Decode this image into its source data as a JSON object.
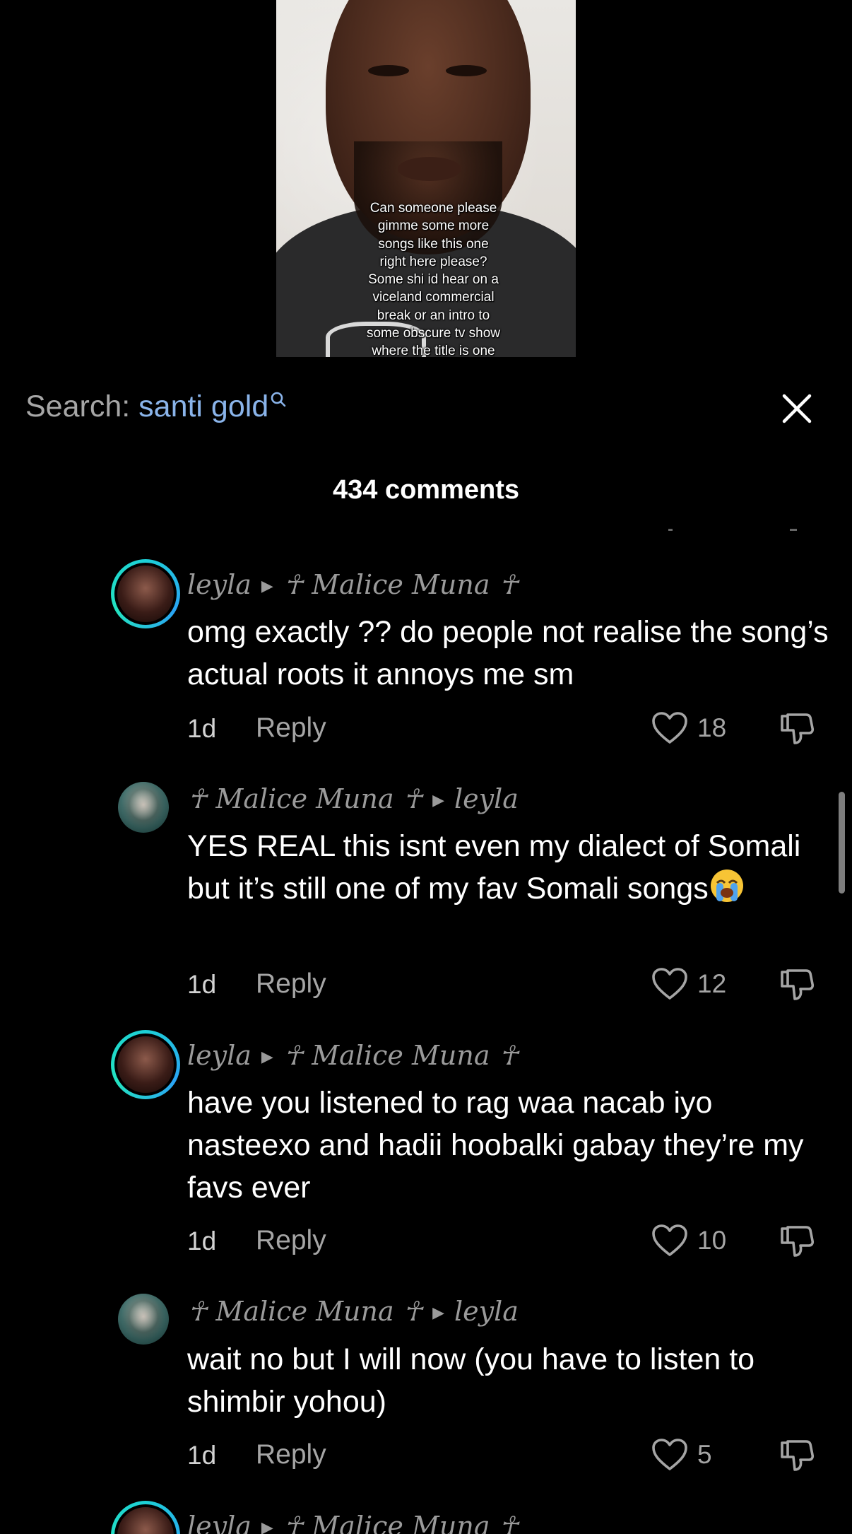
{
  "video": {
    "caption": "Can someone please gimme some more songs like this one right here please? Some shi id hear on a viceland commercial break or an intro to some obscure tv show where the title is one word type shi"
  },
  "search": {
    "label": "Search:",
    "query": "santi gold",
    "icon": "search-icon",
    "query_color": "#8ab4ea"
  },
  "close_icon": "close-icon",
  "header": {
    "count": "434",
    "label": "comments"
  },
  "comments": [
    {
      "author": "leyla",
      "reply_to": "☥ Malice Muna ☥",
      "text": "omg exactly ?? do people not realise the song’s actual roots it annoys me sm",
      "time": "1d",
      "reply_label": "Reply",
      "likes": "18"
    },
    {
      "author": "☥ Malice Muna ☥",
      "reply_to": "leyla",
      "text": "YES REAL this isnt even my dialect of Somali but it’s still one of my fav Somali songs",
      "emoji": "loudly-crying-face",
      "time": "1d",
      "reply_label": "Reply",
      "likes": "12"
    },
    {
      "author": "leyla",
      "reply_to": "☥ Malice Muna ☥",
      "text": "have you listened to rag waa nacab iyo nasteexo and hadii hoobalki gabay they’re my favs ever",
      "time": "1d",
      "reply_label": "Reply",
      "likes": "10"
    },
    {
      "author": "☥ Malice Muna ☥",
      "reply_to": "leyla",
      "text": "wait no but I will now (you have to listen to shimbir yohou)",
      "time": "1d",
      "reply_label": "Reply",
      "likes": "5"
    },
    {
      "author": "leyla",
      "reply_to": "☥ Malice Muna ☥"
    }
  ],
  "colors": {
    "background": "#000000",
    "ring_accent": "#1dd0d6",
    "muted_text": "#a5a5a5"
  }
}
